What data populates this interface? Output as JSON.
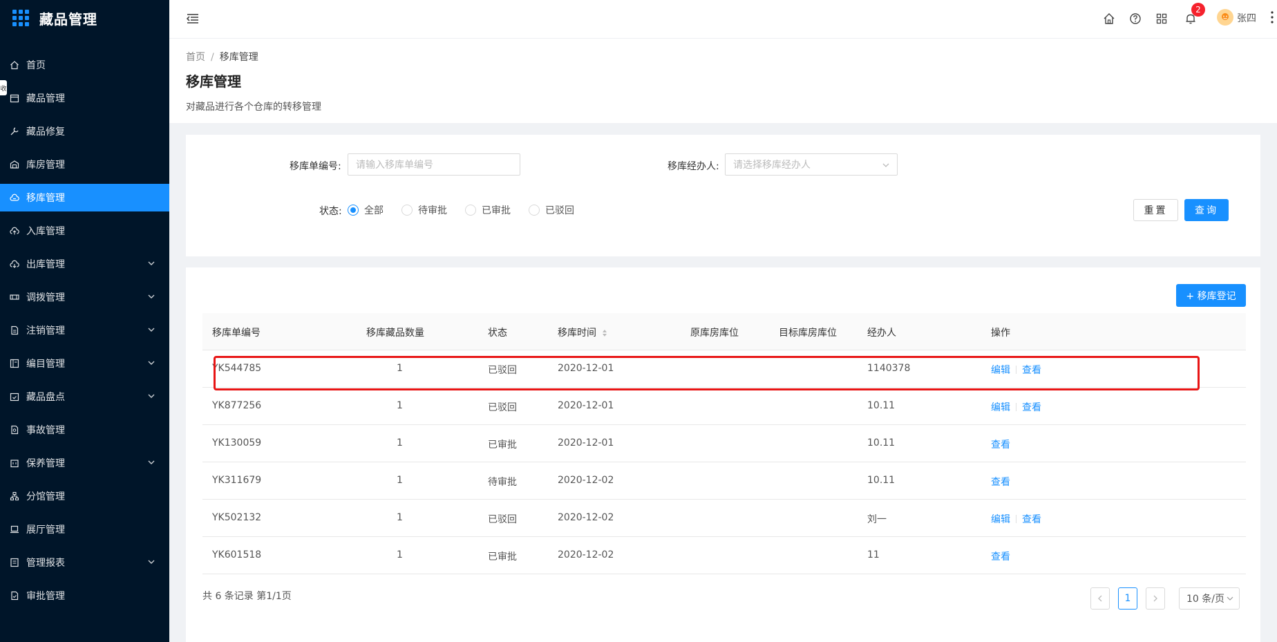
{
  "app": {
    "title": "藏品管理"
  },
  "sidebar": {
    "tab_char": "收",
    "items": [
      {
        "label": "首页",
        "icon": "home-icon",
        "active": false,
        "expandable": false
      },
      {
        "label": "藏品管理",
        "icon": "calendar-icon",
        "active": false,
        "expandable": false
      },
      {
        "label": "藏品修复",
        "icon": "wrench-icon",
        "active": false,
        "expandable": false
      },
      {
        "label": "库房管理",
        "icon": "warehouse-icon",
        "active": false,
        "expandable": false
      },
      {
        "label": "移库管理",
        "icon": "cloud-transfer-icon",
        "active": true,
        "expandable": false
      },
      {
        "label": "入库管理",
        "icon": "cloud-upload-icon",
        "active": false,
        "expandable": false
      },
      {
        "label": "出库管理",
        "icon": "cloud-download-icon",
        "active": false,
        "expandable": true
      },
      {
        "label": "调拨管理",
        "icon": "transfer-icon",
        "active": false,
        "expandable": true
      },
      {
        "label": "注销管理",
        "icon": "file-icon",
        "active": false,
        "expandable": true
      },
      {
        "label": "编目管理",
        "icon": "catalog-icon",
        "active": false,
        "expandable": true
      },
      {
        "label": "藏品盘点",
        "icon": "calendar-check-icon",
        "active": false,
        "expandable": true
      },
      {
        "label": "事故管理",
        "icon": "file-search-icon",
        "active": false,
        "expandable": false
      },
      {
        "label": "保养管理",
        "icon": "building-icon",
        "active": false,
        "expandable": true
      },
      {
        "label": "分馆管理",
        "icon": "org-icon",
        "active": false,
        "expandable": false
      },
      {
        "label": "展厅管理",
        "icon": "laptop-icon",
        "active": false,
        "expandable": false
      },
      {
        "label": "管理报表",
        "icon": "report-icon",
        "active": false,
        "expandable": true
      },
      {
        "label": "审批管理",
        "icon": "audit-icon",
        "active": false,
        "expandable": false
      }
    ]
  },
  "header": {
    "notification_count": "2",
    "username": "张四"
  },
  "page": {
    "breadcrumb": {
      "home": "首页",
      "separator": "/",
      "current": "移库管理"
    },
    "title": "移库管理",
    "description": "对藏品进行各个仓库的转移管理"
  },
  "search": {
    "order_no_label": "移库单编号:",
    "order_no_placeholder": "请输入移库单编号",
    "handler_label": "移库经办人:",
    "handler_placeholder": "请选择移库经办人",
    "status_label": "状态:",
    "status_options": [
      {
        "label": "全部",
        "checked": true
      },
      {
        "label": "待审批",
        "checked": false
      },
      {
        "label": "已审批",
        "checked": false
      },
      {
        "label": "已驳回",
        "checked": false
      }
    ],
    "reset_label": "重置",
    "query_label": "查询"
  },
  "table": {
    "add_label": "+ 移库登记",
    "columns": [
      "移库单编号",
      "移库藏品数量",
      "状态",
      "移库时间",
      "原库房库位",
      "目标库房库位",
      "经办人",
      "操作"
    ],
    "rows": [
      {
        "no": "YK544785",
        "qty": "1",
        "status": "已驳回",
        "time": "2020-12-01",
        "from": "",
        "to": "",
        "handler": "1140378",
        "ops": [
          "编辑",
          "查看"
        ]
      },
      {
        "no": "YK877256",
        "qty": "1",
        "status": "已驳回",
        "time": "2020-12-01",
        "from": "",
        "to": "",
        "handler": "10.11",
        "ops": [
          "编辑",
          "查看"
        ]
      },
      {
        "no": "YK130059",
        "qty": "1",
        "status": "已审批",
        "time": "2020-12-01",
        "from": "",
        "to": "",
        "handler": "10.11",
        "ops": [
          "查看"
        ]
      },
      {
        "no": "YK311679",
        "qty": "1",
        "status": "待审批",
        "time": "2020-12-02",
        "from": "",
        "to": "",
        "handler": "10.11",
        "ops": [
          "查看"
        ]
      },
      {
        "no": "YK502132",
        "qty": "1",
        "status": "已驳回",
        "time": "2020-12-02",
        "from": "",
        "to": "",
        "handler": "刘一",
        "ops": [
          "编辑",
          "查看"
        ]
      },
      {
        "no": "YK601518",
        "qty": "1",
        "status": "已审批",
        "time": "2020-12-02",
        "from": "",
        "to": "",
        "handler": "11",
        "ops": [
          "查看"
        ]
      }
    ],
    "highlighted_row": 0
  },
  "pagination": {
    "total_text": "共 6 条记录 第1/1页",
    "current_page": "1",
    "page_size": "10 条/页"
  },
  "colors": {
    "sidebar_bg": "#001529",
    "primary": "#1890ff",
    "badge": "#f5222d",
    "highlight": "#e81515"
  }
}
